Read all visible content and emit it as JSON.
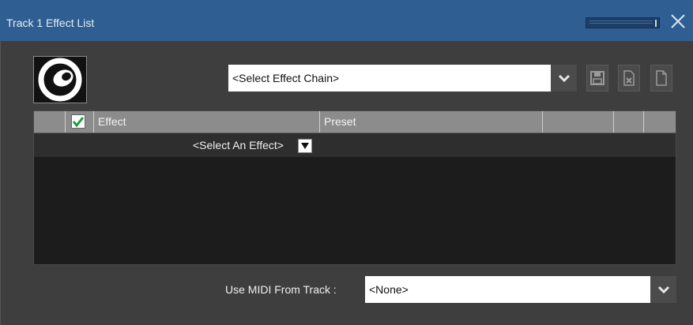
{
  "window": {
    "title": "Track 1 Effect List",
    "accent": "#2f5f92",
    "background": "#3e3e3e"
  },
  "icons": {
    "app_logo": "app-logo-icon",
    "meter": "level-meter-icon",
    "close": "close-icon",
    "chevron": "chevron-down-icon",
    "save": "save-icon",
    "delete": "delete-file-icon",
    "new": "new-file-icon",
    "check": "checkmark-icon"
  },
  "effect_chain": {
    "value": "<Select Effect Chain>"
  },
  "table": {
    "columns": [
      "Effect",
      "Preset",
      "",
      "",
      ""
    ],
    "enabled_all": true,
    "rows": [
      {
        "effect": "<Select An Effect>"
      }
    ]
  },
  "midi": {
    "label": "Use MIDI From Track :",
    "value": "<None>"
  }
}
